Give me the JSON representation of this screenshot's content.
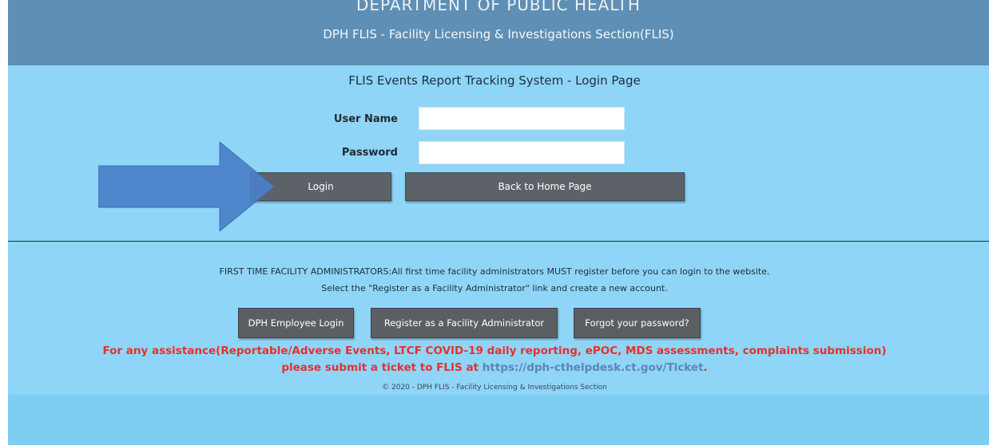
{
  "header": {
    "department": "DEPARTMENT OF PUBLIC HEALTH",
    "section": "DPH FLIS - Facility Licensing & Investigations Section(FLIS)"
  },
  "page": {
    "title": "FLIS Events Report Tracking System - Login Page"
  },
  "form": {
    "username_label": "User Name",
    "username_value": "",
    "password_label": "Password",
    "password_value": "",
    "login_label": "Login",
    "back_label": "Back to Home Page"
  },
  "notice": {
    "line1": "FIRST TIME FACILITY ADMINISTRATORS:All first time facility administrators MUST register before you can login to the website.",
    "line2": "Select the \"Register as a Facility Administrator\" link and create a new account."
  },
  "links": {
    "employee_login": "DPH Employee Login",
    "register": "Register as a Facility Administrator",
    "forgot": "Forgot your password?"
  },
  "assistance": {
    "line1": "For any assistance(Reportable/Adverse Events, LTCF COVID-19 daily reporting, ePOC, MDS assessments, complaints submission)",
    "line2_prefix": "please submit a ticket to FLIS at ",
    "ticket_url": "https://dph-cthelpdesk.ct.gov/Ticket",
    "line2_suffix": "."
  },
  "footer": {
    "copyright": "© 2020 - DPH FLIS - Facility Licensing & Investigations Section"
  },
  "icons": {
    "arrow": "right-arrow-icon"
  },
  "colors": {
    "header_bg": "#5f8fb4",
    "page_bg": "#7ecef4",
    "button_bg": "#5d6268",
    "alert_text": "#e8302a",
    "link_text": "#5b86b8",
    "arrow_fill": "#4a7fc8"
  }
}
